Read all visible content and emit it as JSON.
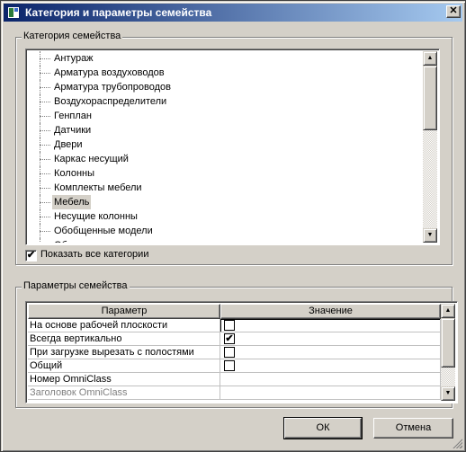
{
  "window": {
    "title": "Категория и параметры семейства",
    "close_glyph": "✕"
  },
  "category_group": {
    "legend": "Категория семейства",
    "items": [
      "Антураж",
      "Арматура воздуховодов",
      "Арматура трубопроводов",
      "Воздухораспределители",
      "Генплан",
      "Датчики",
      "Двери",
      "Каркас несущий",
      "Колонны",
      "Комплекты мебели",
      "Мебель",
      "Несущие колонны",
      "Обобщенные модели",
      "Об..."
    ],
    "selected_index": 10,
    "show_all": {
      "label": "Показать все категории",
      "checked": true
    }
  },
  "params_group": {
    "legend": "Параметры семейства",
    "columns": [
      "Параметр",
      "Значение"
    ],
    "rows": [
      {
        "name": "На основе рабочей плоскости",
        "value": "unchecked",
        "disabled": false
      },
      {
        "name": "Всегда вертикально",
        "value": "checked",
        "disabled": false
      },
      {
        "name": "При загрузке вырезать с полостями",
        "value": "unchecked",
        "disabled": false
      },
      {
        "name": "Общий",
        "value": "unchecked",
        "disabled": false
      },
      {
        "name": "Номер OmniClass",
        "value": "",
        "disabled": false
      },
      {
        "name": "Заголовок OmniClass",
        "value": "",
        "disabled": true
      }
    ]
  },
  "buttons": {
    "ok": "ОК",
    "cancel": "Отмена"
  },
  "icons": {
    "app": "family-category-icon",
    "scroll_up": "▲",
    "scroll_down": "▼",
    "check": "✔"
  }
}
